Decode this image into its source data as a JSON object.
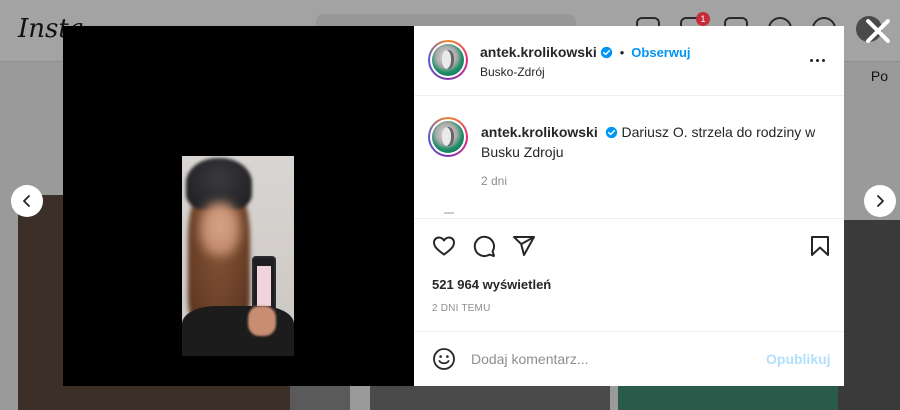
{
  "background": {
    "logo": "Insta",
    "notification_count": "1",
    "side_text": "Po"
  },
  "post": {
    "username": "antek.krolikowski",
    "follow_label": "Obserwuj",
    "separator": "•",
    "location": "Busko-Zdrój",
    "caption_username": "antek.krolikowski",
    "caption_text": "Dariusz O. strzela do rodziny w Busku Zdroju",
    "caption_time": "2 dni",
    "views": "521 964 wyświetleń",
    "date": "2 DNI TEMU"
  },
  "comment": {
    "placeholder": "Dodaj komentarz...",
    "post_label": "Opublikuj"
  },
  "icons": {
    "close": "close-icon",
    "prev": "chevron-left-icon",
    "next": "chevron-right-icon",
    "like": "heart-icon",
    "comment": "comment-icon",
    "share": "share-icon",
    "save": "bookmark-icon",
    "emoji": "emoji-icon",
    "more": "more-icon",
    "verified": "verified-badge-icon"
  },
  "colors": {
    "accent": "#0095f6",
    "post_disabled": "#b2dffc",
    "verified": "#0095f6"
  }
}
